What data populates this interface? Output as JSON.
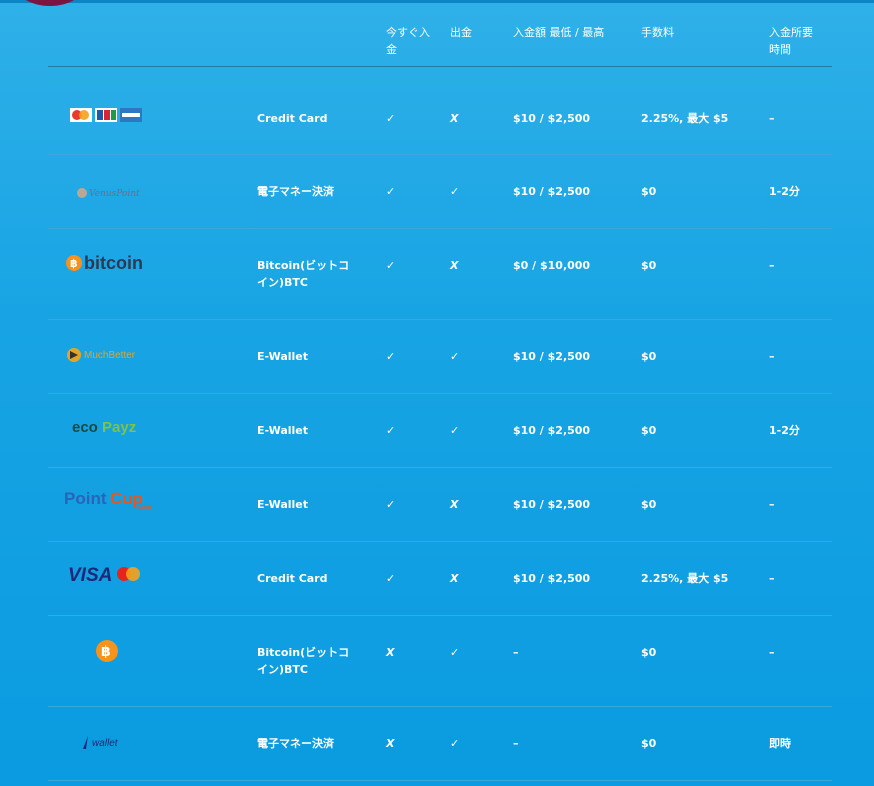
{
  "header": {
    "col_instant": "今すぐ入金",
    "col_withdraw": "出金",
    "col_amount": "入金額 最低 / 最高",
    "col_fee": "手数料",
    "col_time": "入金所要時間"
  },
  "rows": [
    {
      "logo": "mastercard-jcb-amex-logo",
      "method": "Credit Card",
      "instant": "✓",
      "withdraw": "X",
      "amount": "$10 / $2,500",
      "fee": "2.25%, 最大 $5",
      "time": "–"
    },
    {
      "logo": "venuspoint-logo",
      "logo_text": "VenusPoint",
      "method": "電子マネー決済",
      "instant": "✓",
      "withdraw": "✓",
      "amount": "$10 / $2,500",
      "fee": "$0",
      "time": "1-2分"
    },
    {
      "logo": "bitcoin-logo",
      "logo_text": "bitcoin",
      "method": "Bitcoin(ビットコイン)BTC",
      "instant": "✓",
      "withdraw": "X",
      "amount": "$0 / $10,000",
      "fee": "$0",
      "time": "–"
    },
    {
      "logo": "muchbetter-logo",
      "logo_text": "MuchBetter",
      "method": "E-Wallet",
      "instant": "✓",
      "withdraw": "✓",
      "amount": "$10 / $2,500",
      "fee": "$0",
      "time": "–"
    },
    {
      "logo": "ecopayz-logo",
      "logo_text_a": "eco",
      "logo_text_b": "Payz",
      "method": "E-Wallet",
      "instant": "✓",
      "withdraw": "✓",
      "amount": "$10 / $2,500",
      "fee": "$0",
      "time": "1-2分"
    },
    {
      "logo": "pointcup-logo",
      "logo_text_a": "Point",
      "logo_text_b": "Cup",
      "logo_text_c": ".com",
      "method": "E-Wallet",
      "instant": "✓",
      "withdraw": "X",
      "amount": "$10 / $2,500",
      "fee": "$0",
      "time": "–"
    },
    {
      "logo": "visa-mastercard-logo",
      "logo_text": "VISA",
      "method": "Credit Card",
      "instant": "✓",
      "withdraw": "X",
      "amount": "$10 / $2,500",
      "fee": "2.25%, 最大 $5",
      "time": "–"
    },
    {
      "logo": "bitcoin-coin-logo",
      "method": "Bitcoin(ビットコイン)BTC",
      "instant": "X",
      "withdraw": "✓",
      "amount": "–",
      "fee": "$0",
      "time": "–"
    },
    {
      "logo": "ewallet-logo",
      "logo_text": "wallet",
      "method": "電子マネー決済",
      "instant": "X",
      "withdraw": "✓",
      "amount": "–",
      "fee": "$0",
      "time": "即時"
    }
  ]
}
